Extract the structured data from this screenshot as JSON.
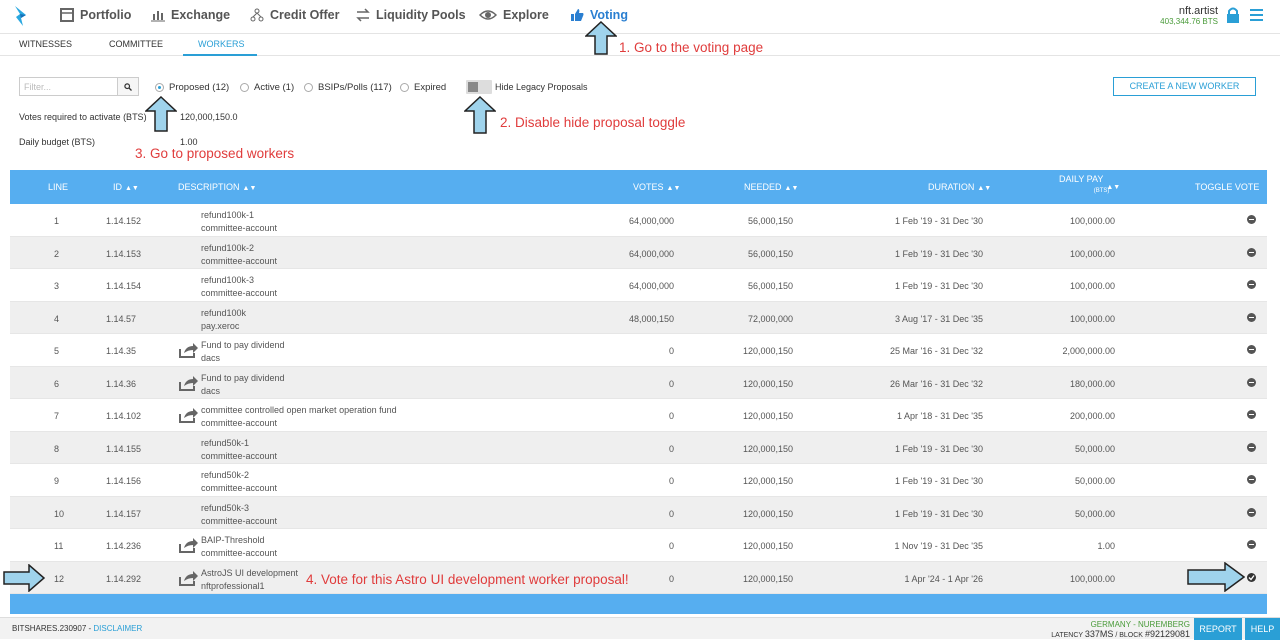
{
  "nav": {
    "items": [
      {
        "label": "Portfolio",
        "icon": "portfolio-icon"
      },
      {
        "label": "Exchange",
        "icon": "exchange-icon"
      },
      {
        "label": "Credit Offer",
        "icon": "credit-offer-icon"
      },
      {
        "label": "Liquidity Pools",
        "icon": "liquidity-icon"
      },
      {
        "label": "Explore",
        "icon": "eye-icon"
      },
      {
        "label": "Voting",
        "icon": "thumbs-up-icon"
      }
    ],
    "active": "Voting",
    "account_name": "nft.artist",
    "account_balance": "403,344.76 BTS"
  },
  "subtabs": [
    "WITNESSES",
    "COMMITTEE",
    "WORKERS"
  ],
  "active_subtab": "WORKERS",
  "filter": {
    "placeholder": "Filter...",
    "button_icon": "search-icon"
  },
  "radios": [
    {
      "label": "Proposed (12)",
      "selected": true
    },
    {
      "label": "Active (1)",
      "selected": false
    },
    {
      "label": "BSIPs/Polls (117)",
      "selected": false
    },
    {
      "label": "Expired",
      "selected": false
    }
  ],
  "hide_legacy": {
    "label": "Hide Legacy Proposals",
    "on": false
  },
  "create_button": "CREATE A NEW WORKER",
  "votes_required": {
    "label": "Votes required to activate (BTS)",
    "value": "120,000,150.0"
  },
  "daily_budget": {
    "label": "Daily budget (BTS)",
    "value": "1.00"
  },
  "annotations": [
    "1. Go to the voting page",
    "2. Disable hide proposal toggle",
    "3. Go to proposed workers",
    "4. Vote for this Astro UI development worker proposal!"
  ],
  "table": {
    "headers": {
      "line": "LINE",
      "id": "ID",
      "description": "DESCRIPTION",
      "votes": "VOTES",
      "needed": "NEEDED",
      "duration": "DURATION",
      "daily_pay": "DAILY PAY",
      "daily_pay_unit": "(BTS)",
      "toggle": "TOGGLE VOTE"
    },
    "rows": [
      {
        "line": "1",
        "id": "1.14.152",
        "name": "refund100k-1",
        "account": "committee-account",
        "votes": "64,000,000",
        "needed": "56,000,150",
        "duration": "1 Feb '19 - 31 Dec '30",
        "pay": "100,000.00",
        "share": false,
        "voted": false
      },
      {
        "line": "2",
        "id": "1.14.153",
        "name": "refund100k-2",
        "account": "committee-account",
        "votes": "64,000,000",
        "needed": "56,000,150",
        "duration": "1 Feb '19 - 31 Dec '30",
        "pay": "100,000.00",
        "share": false,
        "voted": false
      },
      {
        "line": "3",
        "id": "1.14.154",
        "name": "refund100k-3",
        "account": "committee-account",
        "votes": "64,000,000",
        "needed": "56,000,150",
        "duration": "1 Feb '19 - 31 Dec '30",
        "pay": "100,000.00",
        "share": false,
        "voted": false
      },
      {
        "line": "4",
        "id": "1.14.57",
        "name": "refund100k",
        "account": "pay.xeroc",
        "votes": "48,000,150",
        "needed": "72,000,000",
        "duration": "3 Aug '17 - 31 Dec '35",
        "pay": "100,000.00",
        "share": false,
        "voted": false
      },
      {
        "line": "5",
        "id": "1.14.35",
        "name": "Fund to pay dividend",
        "account": "dacs",
        "votes": "0",
        "needed": "120,000,150",
        "duration": "25 Mar '16 - 31 Dec '32",
        "pay": "2,000,000.00",
        "share": true,
        "voted": false
      },
      {
        "line": "6",
        "id": "1.14.36",
        "name": "Fund to pay dividend",
        "account": "dacs",
        "votes": "0",
        "needed": "120,000,150",
        "duration": "26 Mar '16 - 31 Dec '32",
        "pay": "180,000.00",
        "share": true,
        "voted": false
      },
      {
        "line": "7",
        "id": "1.14.102",
        "name": "committee controlled open market operation fund",
        "account": "committee-account",
        "votes": "0",
        "needed": "120,000,150",
        "duration": "1 Apr '18 - 31 Dec '35",
        "pay": "200,000.00",
        "share": true,
        "voted": false
      },
      {
        "line": "8",
        "id": "1.14.155",
        "name": "refund50k-1",
        "account": "committee-account",
        "votes": "0",
        "needed": "120,000,150",
        "duration": "1 Feb '19 - 31 Dec '30",
        "pay": "50,000.00",
        "share": false,
        "voted": false
      },
      {
        "line": "9",
        "id": "1.14.156",
        "name": "refund50k-2",
        "account": "committee-account",
        "votes": "0",
        "needed": "120,000,150",
        "duration": "1 Feb '19 - 31 Dec '30",
        "pay": "50,000.00",
        "share": false,
        "voted": false
      },
      {
        "line": "10",
        "id": "1.14.157",
        "name": "refund50k-3",
        "account": "committee-account",
        "votes": "0",
        "needed": "120,000,150",
        "duration": "1 Feb '19 - 31 Dec '30",
        "pay": "50,000.00",
        "share": false,
        "voted": false
      },
      {
        "line": "11",
        "id": "1.14.236",
        "name": "BAIP-Threshold",
        "account": "committee-account",
        "votes": "0",
        "needed": "120,000,150",
        "duration": "1 Nov '19 - 31 Dec '35",
        "pay": "1.00",
        "share": true,
        "voted": false
      },
      {
        "line": "12",
        "id": "1.14.292",
        "name": "AstroJS UI development",
        "account": "nftprofessional1",
        "votes": "0",
        "needed": "120,000,150",
        "duration": "1 Apr '24 - 1 Apr '26",
        "pay": "100,000.00",
        "share": true,
        "voted": true
      }
    ]
  },
  "footer": {
    "version": "BITSHARES.230907",
    "disclaimer": "DISCLAIMER",
    "node_location": "GERMANY - NUREMBERG",
    "latency_label": "LATENCY",
    "latency": "337MS",
    "block_label": "BLOCK",
    "block": "#92129081",
    "report": "REPORT",
    "help": "HELP"
  },
  "colors": {
    "accent": "#2a9fd6",
    "header_blue": "#56aef0",
    "annotation_red": "#e03c3c",
    "arrow_fill": "#9fd3ec"
  }
}
